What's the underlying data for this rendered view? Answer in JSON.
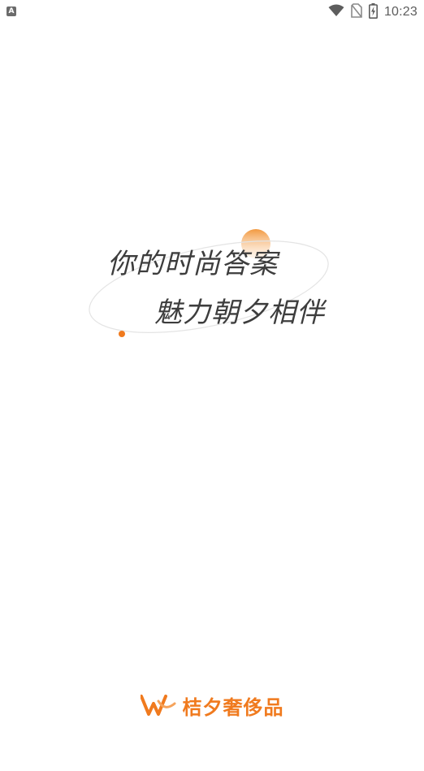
{
  "status_bar": {
    "left_icon": "A",
    "time": "10:23",
    "icons": [
      "wifi-icon",
      "no-sim-icon",
      "battery-charging-icon"
    ]
  },
  "splash": {
    "line1": "你的时尚答案",
    "line2": "魅力朝夕相伴"
  },
  "brand": {
    "name": "桔夕奢侈品",
    "logo": "w-logo-icon"
  },
  "colors": {
    "accent": "#f07a1e",
    "text": "#3d3d3d",
    "orbit": "#e6e6e6",
    "background": "#ffffff"
  }
}
